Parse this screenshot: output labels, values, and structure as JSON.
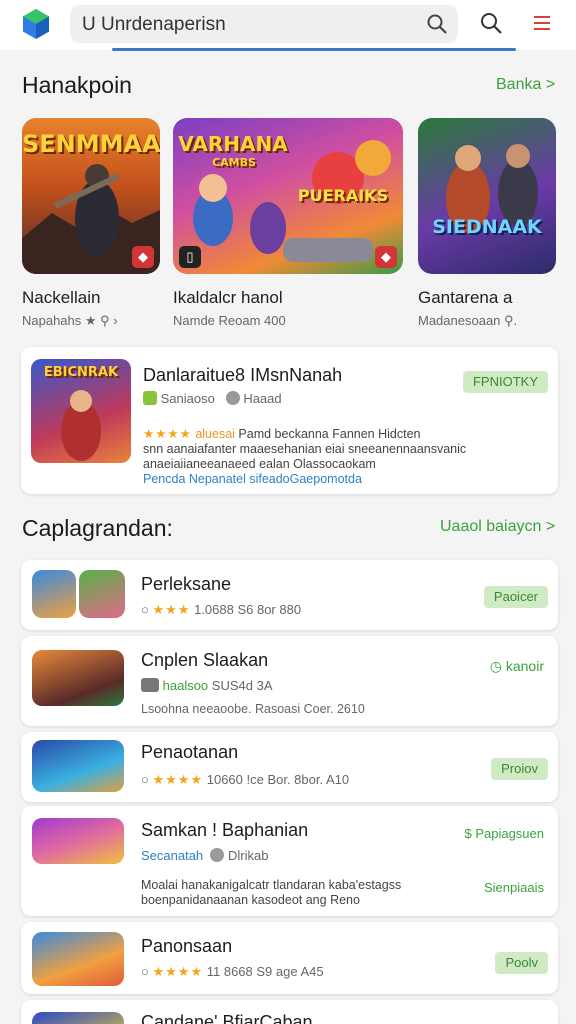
{
  "header": {
    "search_query": "U Unrdenaperisn"
  },
  "featured": {
    "title": "Hanakpoin",
    "see_all": "Banka >",
    "items": [
      {
        "art_title": "SENMMAA",
        "name": "Nackellain",
        "sub": "Napahahs ★ ⚲ ›"
      },
      {
        "art_title": "VARHANA",
        "art_subtitle": "CAMBS",
        "art_title2": "PUERAIKS",
        "name": "Ikaldalcr hanol",
        "sub": "Namde Reoam  400"
      },
      {
        "art_title": "SIEDNAAK",
        "name": "Gantarena a",
        "sub": "Madanesoaan ⚲."
      }
    ]
  },
  "promo": {
    "art_title": "EBICNRAK",
    "title": "Danlaraitue8 IMsnNanah",
    "button": "FPNIOTKY",
    "publisher": "Saniaoso",
    "meta": "Haaad",
    "rating_label": "aluesai",
    "desc1": "Pamd beckanna Fannen Hidcten",
    "desc2": "snn aanaiafanter maaesehanian eiai sneeanennaansvanic",
    "desc3": "anaeiaiianeeanaeed ealan Olassocaokam",
    "link": "Pencda Nepanatel sifeadoGaepomotda"
  },
  "popular": {
    "title": "Caplagrandan:",
    "see_all": "Uaaol baiaycn >",
    "items": [
      {
        "title": "Perleksane",
        "meta": "1.0688 S6 8or  880",
        "button": "Paoicer"
      },
      {
        "title": "Cnplen Slaakan",
        "tag": "haalsoo",
        "meta": "SUS4d 3A",
        "desc": "Lsoohna neeaoobe. Rasoasi Coer. 2610",
        "button": "kanoir"
      },
      {
        "title": "Penaotanan",
        "meta": "10660 !ce Bor. 8bor. A10",
        "button": "Proiov"
      },
      {
        "title": "Samkan ! Baphanian",
        "tag": "Secanatah",
        "meta": "Dlrikab",
        "desc1": "Moalai hanakanigalcatr tlandaran kaba'estagss",
        "desc2": "boenpanidanaanan kasodeot ang Reno",
        "button": "$ Papiagsuen",
        "link": "Sienpiaais"
      },
      {
        "title": "Panonsaan",
        "meta": "11 8668 S9 age A45",
        "button": "Poolv"
      }
    ],
    "partial_title": "Candane' BfiarCaban"
  },
  "colors": {
    "accent": "#3aa23e",
    "brand": "#3b78c6",
    "pill": "#cfeac4"
  }
}
